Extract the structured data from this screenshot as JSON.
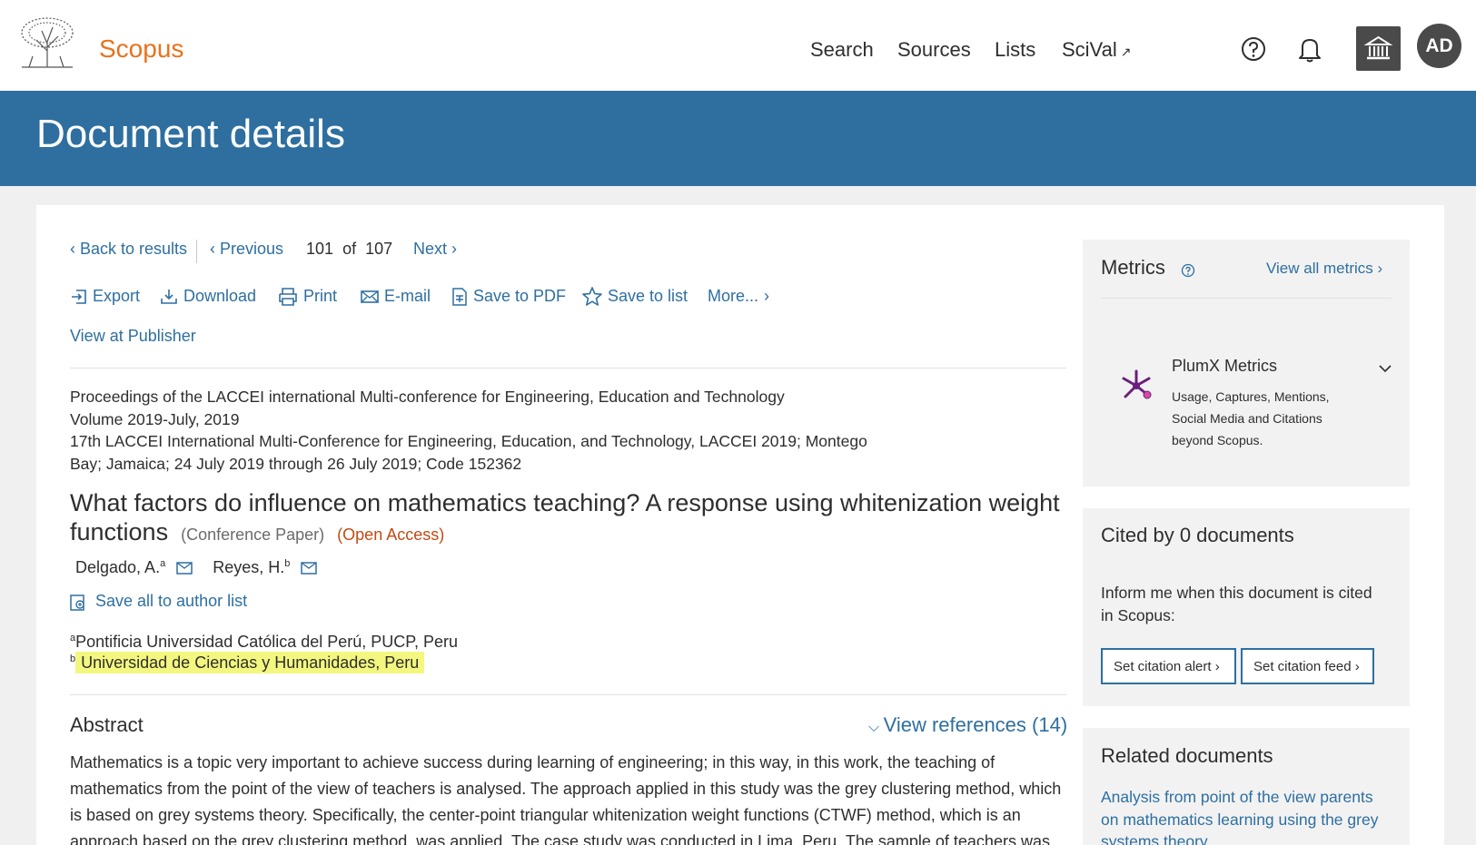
{
  "brand": {
    "name": "Scopus"
  },
  "nav": {
    "items": [
      {
        "label": "Search"
      },
      {
        "label": "Sources"
      },
      {
        "label": "Lists"
      },
      {
        "label": "SciVal",
        "external_mark": "↗"
      }
    ],
    "avatar_initials": "AD"
  },
  "page_title": "Document details",
  "pager": {
    "back": "Back to results",
    "previous": "Previous",
    "current": "101",
    "of": "of",
    "total": "107",
    "next": "Next"
  },
  "toolbar": {
    "export": "Export",
    "download": "Download",
    "print": "Print",
    "email": "E-mail",
    "save_pdf": "Save to PDF",
    "save_list": "Save to list",
    "more": "More...",
    "view_publisher": "View at Publisher"
  },
  "source": {
    "line1": "Proceedings of the LACCEI international Multi-conference for Engineering, Education and Technology",
    "line2": "Volume 2019-July, 2019",
    "line3": "17th LACCEI International Multi-Conference for Engineering, Education, and Technology, LACCEI 2019; Montego",
    "line4": "Bay; Jamaica; 24 July 2019 through 26 July 2019; Code 152362"
  },
  "document": {
    "title": "What factors do influence on mathematics teaching? A response using whitenization weight functions",
    "type": "(Conference Paper)",
    "access": "(Open Access)"
  },
  "authors": [
    {
      "name": "Delgado, A.",
      "sup": "a"
    },
    {
      "name": "Reyes, H.",
      "sup": "b"
    }
  ],
  "save_authors": "Save all to author list",
  "affiliations": [
    {
      "sup": "a",
      "text": "Pontificia Universidad Católica del Perú, PUCP, Peru"
    },
    {
      "sup": "b",
      "text": "Universidad de Ciencias y Humanidades, Peru"
    }
  ],
  "abstract": {
    "heading": "Abstract",
    "view_references": "View references (14)",
    "text": "Mathematics is a topic very important to achieve success during learning of engineering; in this way, in this work, the teaching of mathematics from the point of the view of teachers is analysed. The approach applied in this study was the grey clustering method, which is based on grey systems theory. Specifically, the center-point triangular whitenization weight functions (CTWF) method, which is an approach based on the grey clustering method, was applied. The case study was conducted in Lima, Peru. The sample of teachers was"
  },
  "metrics": {
    "heading": "Metrics",
    "view_all": "View all metrics",
    "plumx_title": "PlumX Metrics",
    "plumx_line1": "Usage, Captures, Mentions,",
    "plumx_line2": "Social Media and Citations",
    "plumx_line3": "beyond Scopus."
  },
  "cited_by": {
    "heading": "Cited by 0 documents",
    "info_line1": "Inform me when this document is cited",
    "info_line2": "in Scopus:",
    "alert_btn": "Set citation alert",
    "feed_btn": "Set citation feed"
  },
  "related": {
    "heading": "Related documents",
    "line1": "Analysis from point of the view parents",
    "line2": "on mathematics learning using the grey",
    "line3": "systems theory"
  },
  "colors": {
    "brand_orange": "#e9711c",
    "header_blue": "#2e6fa0",
    "link_blue": "#2e6fa0",
    "open_access": "#c24a12",
    "highlight": "#f4f77f",
    "plumx_purple": "#6b1e7c"
  }
}
